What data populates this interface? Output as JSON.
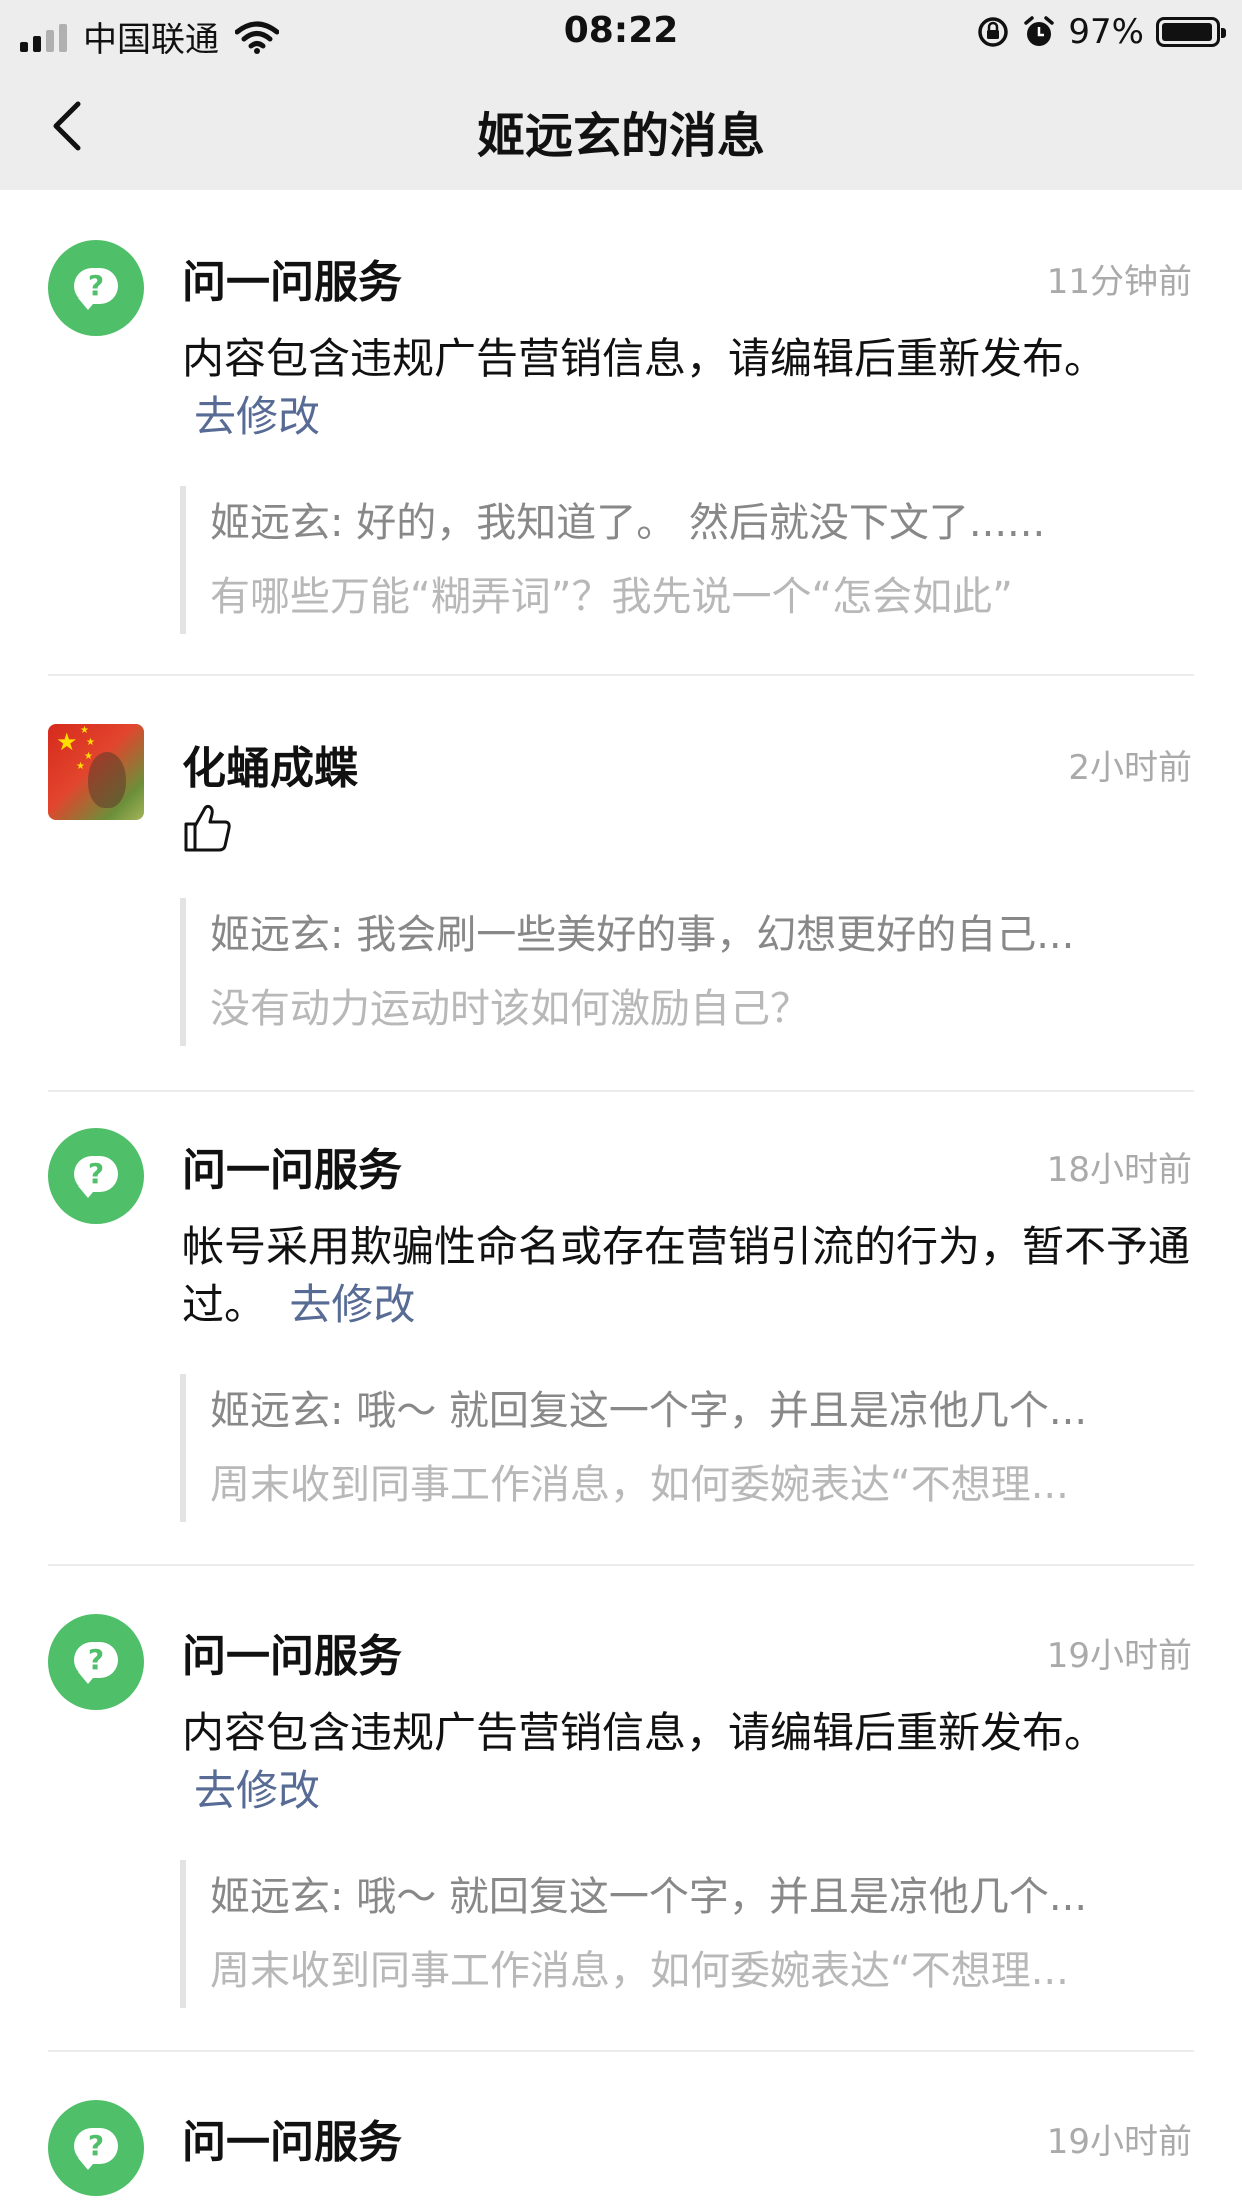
{
  "status_bar": {
    "carrier": "中国联通",
    "time": "08:22",
    "battery_percent": "97%",
    "battery_level": 0.97,
    "icons": [
      "signal-icon",
      "wifi-icon",
      "orientation-lock-icon",
      "alarm-icon",
      "battery-icon"
    ]
  },
  "header": {
    "title": "姬远玄的消息",
    "back_icon": "chevron-left-icon"
  },
  "messages": [
    {
      "name": "问一问服务",
      "time": "11分钟前",
      "avatar": "question-bubble-icon",
      "content": "内容包含违规广告营销信息，请编辑后重新发布。",
      "link": "去修改",
      "quote_line1": "姬远玄: 好的，我知道了。 然后就没下文了......",
      "quote_line2": "有哪些万能“糊弄词”？我先说一个“怎会如此”"
    },
    {
      "name": "化蛹成蝶",
      "time": "2小时前",
      "avatar": "user-avatar-photo",
      "content_icon": "thumbs-up-icon",
      "quote_line1": "姬远玄: 我会刷一些美好的事，幻想更好的自己...",
      "quote_line2": "没有动力运动时该如何激励自己？"
    },
    {
      "name": "问一问服务",
      "time": "18小时前",
      "avatar": "question-bubble-icon",
      "content": "帐号采用欺骗性命名或存在营销引流的行为，暂不予通过。",
      "link": "去修改",
      "quote_line1": "姬远玄: 哦～ 就回复这一个字，并且是凉他几个...",
      "quote_line2": "周末收到同事工作消息，如何委婉表达“不想理..."
    },
    {
      "name": "问一问服务",
      "time": "19小时前",
      "avatar": "question-bubble-icon",
      "content": "内容包含违规广告营销信息，请编辑后重新发布。",
      "link": "去修改",
      "quote_line1": "姬远玄: 哦～ 就回复这一个字，并且是凉他几个...",
      "quote_line2": "周末收到同事工作消息，如何委婉表达“不想理..."
    },
    {
      "name": "问一问服务",
      "time": "19小时前",
      "avatar": "question-bubble-icon"
    }
  ],
  "colors": {
    "header_bg": "#ededed",
    "avatar_green": "#4fbf6a",
    "link_blue": "#576b95",
    "timestamp_gray": "#aaaaaa",
    "quote_primary": "#888888",
    "quote_secondary": "#b8b8b8"
  }
}
